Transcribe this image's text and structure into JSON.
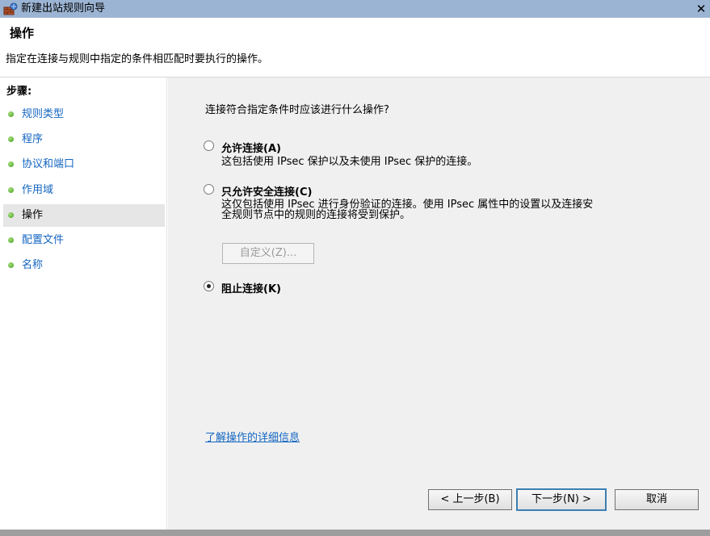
{
  "window": {
    "title": "新建出站规则向导",
    "close_glyph": "✕"
  },
  "header": {
    "title": "操作",
    "description": "指定在连接与规则中指定的条件相匹配时要执行的操作。"
  },
  "sidebar": {
    "steps_label": "步骤:",
    "items": [
      {
        "label": "规则类型",
        "active": false
      },
      {
        "label": "程序",
        "active": false
      },
      {
        "label": "协议和端口",
        "active": false
      },
      {
        "label": "作用域",
        "active": false
      },
      {
        "label": "操作",
        "active": true
      },
      {
        "label": "配置文件",
        "active": false
      },
      {
        "label": "名称",
        "active": false
      }
    ]
  },
  "main": {
    "question": "连接符合指定条件时应该进行什么操作?",
    "options": [
      {
        "label": "允许连接(A)",
        "description": "这包括使用 IPsec 保护以及未使用 IPsec 保护的连接。",
        "checked": false
      },
      {
        "label": "只允许安全连接(C)",
        "description_line1": "这仅包括使用 IPsec 进行身份验证的连接。使用 IPsec 属性中的设置以及连接安",
        "description_line2": "全规则节点中的规则的连接将受到保护。",
        "checked": false
      },
      {
        "label": "阻止连接(K)",
        "checked": true
      }
    ],
    "customize_button": "自定义(Z)...",
    "learn_more_link": "了解操作的详细信息"
  },
  "footer": {
    "back_button": "< 上一步(B)",
    "next_button": "下一步(N) >",
    "cancel_button": "取消"
  },
  "colors": {
    "titlebar": "#9cb4d3",
    "link": "#1466c2",
    "main_bg": "#f0f0f0",
    "step_dot": "#3f9a1f"
  }
}
